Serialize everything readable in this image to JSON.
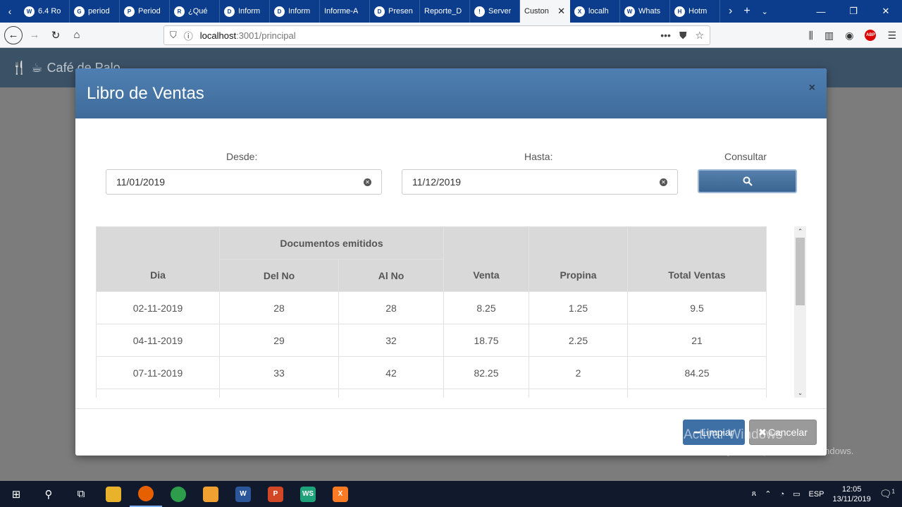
{
  "browser": {
    "tabs": [
      {
        "label": "6.4 Ro",
        "icon": "wordpress-icon",
        "icon_char": "W"
      },
      {
        "label": "period",
        "icon": "google-icon",
        "icon_char": "G"
      },
      {
        "label": "Period",
        "icon": "circle-icon",
        "icon_char": "P"
      },
      {
        "label": "¿Qué",
        "icon": "r-icon",
        "icon_char": "R"
      },
      {
        "label": "Inform",
        "icon": "document-icon",
        "icon_char": "D"
      },
      {
        "label": "Inform",
        "icon": "document-icon",
        "icon_char": "D"
      },
      {
        "label": "Informe-A",
        "icon": "",
        "icon_char": ""
      },
      {
        "label": "Presen",
        "icon": "document-icon",
        "icon_char": "D"
      },
      {
        "label": "Reporte_D",
        "icon": "",
        "icon_char": ""
      },
      {
        "label": "Server",
        "icon": "warning-icon",
        "icon_char": "!"
      },
      {
        "label": "Custon",
        "icon": "",
        "icon_char": "",
        "active": true
      },
      {
        "label": "localh",
        "icon": "xampp-icon",
        "icon_char": "X"
      },
      {
        "label": "Whats",
        "icon": "whatsapp-icon",
        "icon_char": "W"
      },
      {
        "label": "Hotm",
        "icon": "hotmail-icon",
        "icon_char": "H"
      }
    ],
    "url_host": "localhost",
    "url_path": ":3001/principal"
  },
  "app": {
    "brand": "Café de Palo"
  },
  "modal": {
    "title": "Libro de Ventas",
    "desde_label": "Desde:",
    "hasta_label": "Hasta:",
    "consultar_label": "Consultar",
    "desde_value": "11/01/2019",
    "hasta_value": "11/12/2019",
    "table": {
      "group_header": "Documentos emitidos",
      "headers": {
        "dia": "Dia",
        "del_no": "Del No",
        "al_no": "Al No",
        "venta": "Venta",
        "propina": "Propina",
        "total": "Total Ventas"
      },
      "rows": [
        {
          "dia": "02-11-2019",
          "del_no": "28",
          "al_no": "28",
          "venta": "8.25",
          "propina": "1.25",
          "total": "9.5"
        },
        {
          "dia": "04-11-2019",
          "del_no": "29",
          "al_no": "32",
          "venta": "18.75",
          "propina": "2.25",
          "total": "21"
        },
        {
          "dia": "07-11-2019",
          "del_no": "33",
          "al_no": "42",
          "venta": "82.25",
          "propina": "2",
          "total": "84.25"
        }
      ]
    },
    "limpiar_label": "Limpiar",
    "cancelar_label": "Cancelar"
  },
  "watermark": {
    "title": "Activar Windows",
    "subtitle": "Ve a Configuración para activar Windows."
  },
  "taskbar": {
    "language": "ESP",
    "time": "12:05",
    "date": "13/11/2019",
    "notifications": "1"
  },
  "colors": {
    "tabbar": "#0b3d8c",
    "modal_header": "#4a78a8",
    "primary_button": "#3e6fa5",
    "app_header": "#3b5166"
  }
}
